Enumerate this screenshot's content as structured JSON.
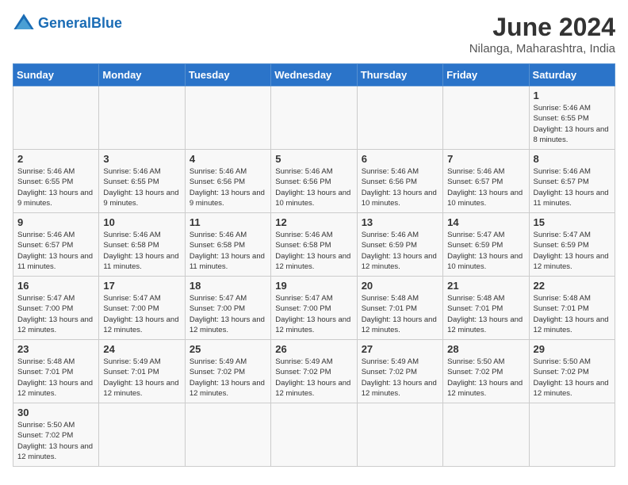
{
  "header": {
    "logo_general": "General",
    "logo_blue": "Blue",
    "month_year": "June 2024",
    "location": "Nilanga, Maharashtra, India"
  },
  "days_of_week": [
    "Sunday",
    "Monday",
    "Tuesday",
    "Wednesday",
    "Thursday",
    "Friday",
    "Saturday"
  ],
  "weeks": [
    [
      null,
      null,
      null,
      null,
      null,
      null,
      {
        "day": "1",
        "sunrise": "Sunrise: 5:46 AM",
        "sunset": "Sunset: 6:55 PM",
        "daylight": "Daylight: 13 hours and 8 minutes."
      }
    ],
    [
      {
        "day": "2",
        "sunrise": "Sunrise: 5:46 AM",
        "sunset": "Sunset: 6:55 PM",
        "daylight": "Daylight: 13 hours and 9 minutes."
      },
      {
        "day": "3",
        "sunrise": "Sunrise: 5:46 AM",
        "sunset": "Sunset: 6:55 PM",
        "daylight": "Daylight: 13 hours and 9 minutes."
      },
      {
        "day": "4",
        "sunrise": "Sunrise: 5:46 AM",
        "sunset": "Sunset: 6:56 PM",
        "daylight": "Daylight: 13 hours and 9 minutes."
      },
      {
        "day": "5",
        "sunrise": "Sunrise: 5:46 AM",
        "sunset": "Sunset: 6:56 PM",
        "daylight": "Daylight: 13 hours and 10 minutes."
      },
      {
        "day": "6",
        "sunrise": "Sunrise: 5:46 AM",
        "sunset": "Sunset: 6:56 PM",
        "daylight": "Daylight: 13 hours and 10 minutes."
      },
      {
        "day": "7",
        "sunrise": "Sunrise: 5:46 AM",
        "sunset": "Sunset: 6:57 PM",
        "daylight": "Daylight: 13 hours and 10 minutes."
      },
      {
        "day": "8",
        "sunrise": "Sunrise: 5:46 AM",
        "sunset": "Sunset: 6:57 PM",
        "daylight": "Daylight: 13 hours and 11 minutes."
      }
    ],
    [
      {
        "day": "9",
        "sunrise": "Sunrise: 5:46 AM",
        "sunset": "Sunset: 6:57 PM",
        "daylight": "Daylight: 13 hours and 11 minutes."
      },
      {
        "day": "10",
        "sunrise": "Sunrise: 5:46 AM",
        "sunset": "Sunset: 6:58 PM",
        "daylight": "Daylight: 13 hours and 11 minutes."
      },
      {
        "day": "11",
        "sunrise": "Sunrise: 5:46 AM",
        "sunset": "Sunset: 6:58 PM",
        "daylight": "Daylight: 13 hours and 11 minutes."
      },
      {
        "day": "12",
        "sunrise": "Sunrise: 5:46 AM",
        "sunset": "Sunset: 6:58 PM",
        "daylight": "Daylight: 13 hours and 12 minutes."
      },
      {
        "day": "13",
        "sunrise": "Sunrise: 5:46 AM",
        "sunset": "Sunset: 6:59 PM",
        "daylight": "Daylight: 13 hours and 12 minutes."
      },
      {
        "day": "14",
        "sunrise": "Sunrise: 5:47 AM",
        "sunset": "Sunset: 6:59 PM",
        "daylight": "Daylight: 13 hours and 10 minutes."
      },
      {
        "day": "15",
        "sunrise": "Sunrise: 5:47 AM",
        "sunset": "Sunset: 6:59 PM",
        "daylight": "Daylight: 13 hours and 12 minutes."
      }
    ],
    [
      {
        "day": "16",
        "sunrise": "Sunrise: 5:47 AM",
        "sunset": "Sunset: 7:00 PM",
        "daylight": "Daylight: 13 hours and 12 minutes."
      },
      {
        "day": "17",
        "sunrise": "Sunrise: 5:47 AM",
        "sunset": "Sunset: 7:00 PM",
        "daylight": "Daylight: 13 hours and 12 minutes."
      },
      {
        "day": "18",
        "sunrise": "Sunrise: 5:47 AM",
        "sunset": "Sunset: 7:00 PM",
        "daylight": "Daylight: 13 hours and 12 minutes."
      },
      {
        "day": "19",
        "sunrise": "Sunrise: 5:47 AM",
        "sunset": "Sunset: 7:00 PM",
        "daylight": "Daylight: 13 hours and 12 minutes."
      },
      {
        "day": "20",
        "sunrise": "Sunrise: 5:48 AM",
        "sunset": "Sunset: 7:01 PM",
        "daylight": "Daylight: 13 hours and 12 minutes."
      },
      {
        "day": "21",
        "sunrise": "Sunrise: 5:48 AM",
        "sunset": "Sunset: 7:01 PM",
        "daylight": "Daylight: 13 hours and 12 minutes."
      },
      {
        "day": "22",
        "sunrise": "Sunrise: 5:48 AM",
        "sunset": "Sunset: 7:01 PM",
        "daylight": "Daylight: 13 hours and 12 minutes."
      }
    ],
    [
      {
        "day": "23",
        "sunrise": "Sunrise: 5:48 AM",
        "sunset": "Sunset: 7:01 PM",
        "daylight": "Daylight: 13 hours and 12 minutes."
      },
      {
        "day": "24",
        "sunrise": "Sunrise: 5:49 AM",
        "sunset": "Sunset: 7:01 PM",
        "daylight": "Daylight: 13 hours and 12 minutes."
      },
      {
        "day": "25",
        "sunrise": "Sunrise: 5:49 AM",
        "sunset": "Sunset: 7:02 PM",
        "daylight": "Daylight: 13 hours and 12 minutes."
      },
      {
        "day": "26",
        "sunrise": "Sunrise: 5:49 AM",
        "sunset": "Sunset: 7:02 PM",
        "daylight": "Daylight: 13 hours and 12 minutes."
      },
      {
        "day": "27",
        "sunrise": "Sunrise: 5:49 AM",
        "sunset": "Sunset: 7:02 PM",
        "daylight": "Daylight: 13 hours and 12 minutes."
      },
      {
        "day": "28",
        "sunrise": "Sunrise: 5:50 AM",
        "sunset": "Sunset: 7:02 PM",
        "daylight": "Daylight: 13 hours and 12 minutes."
      },
      {
        "day": "29",
        "sunrise": "Sunrise: 5:50 AM",
        "sunset": "Sunset: 7:02 PM",
        "daylight": "Daylight: 13 hours and 12 minutes."
      }
    ],
    [
      {
        "day": "30",
        "sunrise": "Sunrise: 5:50 AM",
        "sunset": "Sunset: 7:02 PM",
        "daylight": "Daylight: 13 hours and 12 minutes."
      },
      null,
      null,
      null,
      null,
      null,
      null
    ]
  ]
}
